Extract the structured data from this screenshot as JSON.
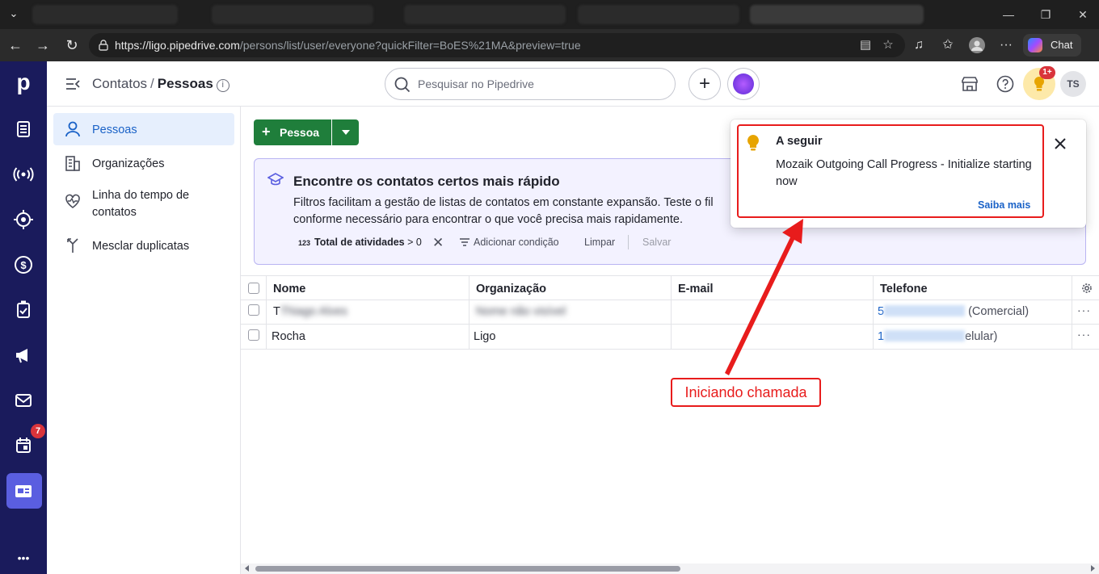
{
  "browser": {
    "url_host": "https://ligo.pipedrive.com",
    "url_path": "/persons/list/user/everyone?quickFilter=BoES%21MA&preview=true",
    "chat_label": "Chat"
  },
  "rail": {
    "logo": "p",
    "calendar_badge": "7",
    "more": "•••"
  },
  "header": {
    "breadcrumb_parent": "Contatos",
    "breadcrumb_sep": "/",
    "breadcrumb_current": "Pessoas",
    "search_placeholder": "Pesquisar no Pipedrive",
    "notif_badge": "1+",
    "avatar_initials": "TS"
  },
  "sidebar": {
    "items": [
      {
        "label": "Pessoas",
        "selected": true
      },
      {
        "label": "Organizações"
      },
      {
        "label": "Linha do tempo de contatos"
      },
      {
        "label": "Mesclar duplicatas"
      }
    ]
  },
  "toolbar": {
    "add_button_label": "Pessoa"
  },
  "tip": {
    "heading": "Encontre os contatos certos mais rápido",
    "body_line1": "Filtros facilitam a gestão de listas de contatos em constante expansão. Teste o fil",
    "body_line2": "conforme necessário para encontrar o que você precisa mais rapidamente.",
    "filter_icon_text": "123",
    "filter_label": "Total de atividades",
    "filter_op": "> 0",
    "add_condition": "Adicionar condição",
    "clear": "Limpar",
    "save": "Salvar"
  },
  "table": {
    "columns": [
      "Nome",
      "Organização",
      "E-mail",
      "Telefone"
    ],
    "rows": [
      {
        "name_visible": "T",
        "name_hidden": "Thiago Alves",
        "org": "Nome não visível",
        "email": "",
        "phone_prefix": "5",
        "phone_suffix": " (Comercial)"
      },
      {
        "name_visible": "Rocha",
        "org": "Ligo",
        "email": "",
        "phone_prefix": "1",
        "phone_suffix": "elular)"
      }
    ],
    "row_menu": "···"
  },
  "toast": {
    "title": "A seguir",
    "message": "Mozaik Outgoing Call Progress - Initialize starting now",
    "link": "Saiba mais"
  },
  "annotation": {
    "label": "Iniciando chamada",
    "color": "#e81c1c"
  },
  "colors": {
    "rail_bg": "#1a1b5c",
    "primary_green": "#1f7e3b",
    "link_blue": "#1a62c7"
  }
}
